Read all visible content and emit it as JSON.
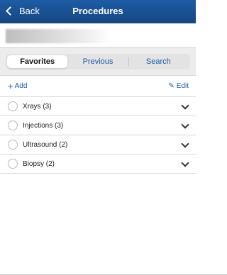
{
  "navbar": {
    "back_label": "Back",
    "title": "Procedures"
  },
  "tabs": [
    {
      "label": "Favorites",
      "active": true
    },
    {
      "label": "Previous",
      "active": false
    },
    {
      "label": "Search",
      "active": false
    }
  ],
  "actions": {
    "add_label": "Add",
    "edit_label": "Edit"
  },
  "categories": [
    {
      "label": "Xrays (3)"
    },
    {
      "label": "Injections (3)"
    },
    {
      "label": "Ultrasound (2)"
    },
    {
      "label": "Biopsy (2)"
    }
  ],
  "colors": {
    "nav_bg": "#1a4f90",
    "accent": "#1f5aa5"
  }
}
